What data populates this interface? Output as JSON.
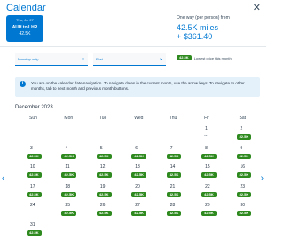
{
  "header": {
    "title": "Calendar",
    "close_label": "✕"
  },
  "selected_card": {
    "date": "Thu, Jul 27",
    "route": "AUH to LHR",
    "price": "42.5K"
  },
  "price_summary": {
    "label": "One way (per person) from",
    "miles": "42.5K miles",
    "cash": "+ $361.40"
  },
  "filters": {
    "stops": "Nonstop only",
    "cabin": "First"
  },
  "legend": {
    "chip": "42.5K",
    "label": "Lowest price this month"
  },
  "info_text": "You are on the calendar date navigation. To navigate dates in the current month, use the arrow keys. To navigate to other months, tab to next month and previous month buttons.",
  "month_label": "December 2023",
  "weekdays": [
    "Sun",
    "Mon",
    "Tue",
    "Wed",
    "Thu",
    "Fri",
    "Sat"
  ],
  "weeks": [
    [
      {
        "day": "",
        "price": ""
      },
      {
        "day": "",
        "price": ""
      },
      {
        "day": "",
        "price": ""
      },
      {
        "day": "",
        "price": ""
      },
      {
        "day": "",
        "price": ""
      },
      {
        "day": "1",
        "price": "--"
      },
      {
        "day": "2",
        "price": "42.5K"
      }
    ],
    [
      {
        "day": "3",
        "price": "42.5K"
      },
      {
        "day": "4",
        "price": "42.5K"
      },
      {
        "day": "5",
        "price": "42.5K"
      },
      {
        "day": "6",
        "price": "42.5K"
      },
      {
        "day": "7",
        "price": "42.5K"
      },
      {
        "day": "8",
        "price": "42.5K"
      },
      {
        "day": "9",
        "price": "42.5K"
      }
    ],
    [
      {
        "day": "10",
        "price": "42.5K"
      },
      {
        "day": "11",
        "price": "42.5K"
      },
      {
        "day": "12",
        "price": "42.5K"
      },
      {
        "day": "13",
        "price": "42.5K"
      },
      {
        "day": "14",
        "price": "42.5K"
      },
      {
        "day": "15",
        "price": "42.5K"
      },
      {
        "day": "16",
        "price": "42.5K"
      }
    ],
    [
      {
        "day": "17",
        "price": "42.5K"
      },
      {
        "day": "18",
        "price": "42.5K"
      },
      {
        "day": "19",
        "price": "42.5K"
      },
      {
        "day": "20",
        "price": "42.5K"
      },
      {
        "day": "21",
        "price": "42.5K"
      },
      {
        "day": "22",
        "price": "42.5K"
      },
      {
        "day": "23",
        "price": "42.5K"
      }
    ],
    [
      {
        "day": "24",
        "price": "--"
      },
      {
        "day": "25",
        "price": "42.5K"
      },
      {
        "day": "26",
        "price": "42.5K"
      },
      {
        "day": "27",
        "price": "42.5K"
      },
      {
        "day": "28",
        "price": "42.5K"
      },
      {
        "day": "29",
        "price": "42.5K"
      },
      {
        "day": "30",
        "price": "42.5K"
      }
    ],
    [
      {
        "day": "31",
        "price": "42.5K"
      },
      {
        "day": "",
        "price": ""
      },
      {
        "day": "",
        "price": ""
      },
      {
        "day": "",
        "price": ""
      },
      {
        "day": "",
        "price": ""
      },
      {
        "day": "",
        "price": ""
      },
      {
        "day": "",
        "price": ""
      }
    ]
  ],
  "colors": {
    "accent": "#0078d2",
    "chip": "#2e8a1e",
    "info_bg": "#e4f1fb"
  },
  "icons": {
    "close": "close-icon",
    "info": "info-icon",
    "prev": "chevron-left-icon",
    "next": "chevron-right-icon",
    "dropdown": "chevron-down-icon"
  }
}
